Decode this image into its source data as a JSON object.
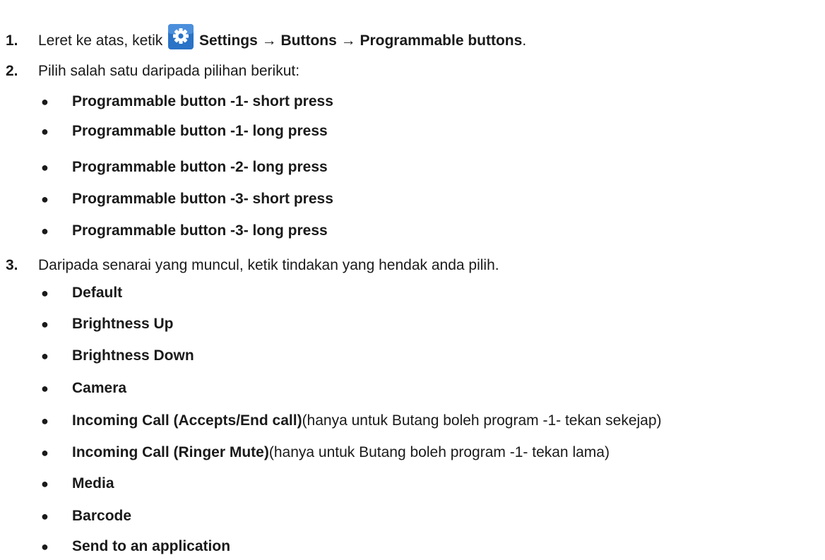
{
  "step1": {
    "number": "1.",
    "text_before": "Leret ke atas, ketik",
    "icon": "settings-gear-icon",
    "icon_bg": "#2a73c7",
    "path": "Settings → Buttons → Programmable buttons",
    "period": "."
  },
  "step2": {
    "number": "2.",
    "text": "Pilih salah satu daripada pilihan berikut:",
    "options": [
      "Programmable button -1- short press",
      "Programmable button -1- long press",
      "Programmable button -2- long press",
      "Programmable button -3- short press",
      "Programmable button -3- long press"
    ]
  },
  "step3": {
    "number": "3.",
    "text": "Daripada senarai yang muncul, ketik tindakan yang hendak anda pilih.",
    "actions": [
      {
        "label": "Default",
        "note": ""
      },
      {
        "label": "Brightness Up",
        "note": ""
      },
      {
        "label": "Brightness Down",
        "note": ""
      },
      {
        "label": "Camera",
        "note": ""
      },
      {
        "label": "Incoming Call (Accepts/End call)",
        "note": "(hanya untuk Butang boleh program -1- tekan sekejap)"
      },
      {
        "label": "Incoming Call (Ringer Mute)",
        "note": "(hanya untuk Butang boleh program -1- tekan lama)"
      },
      {
        "label": "Media",
        "note": ""
      },
      {
        "label": "Barcode",
        "note": ""
      },
      {
        "label": "Send to an application",
        "note": ""
      }
    ]
  },
  "bullet_char": "●"
}
